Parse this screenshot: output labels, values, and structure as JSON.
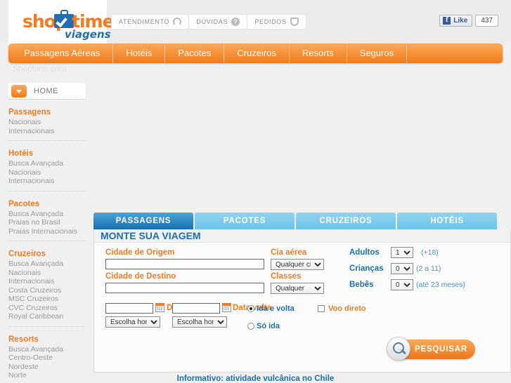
{
  "brand": {
    "logo_shop": "shop",
    "logo_time": "time",
    "logo_sub": "viagens",
    "site_label": "Shoptime.com"
  },
  "topbar": {
    "links": [
      {
        "label": "ATENDIMENTO",
        "icon": "headset-icon"
      },
      {
        "label": "DÚVIDAS",
        "icon": "question-circle-icon"
      },
      {
        "label": "PEDIDOS",
        "icon": "package-box-icon"
      }
    ],
    "facebook": {
      "like_label": "Like",
      "f_glyph": "f",
      "count": "437"
    }
  },
  "mainnav": {
    "items": [
      "Passagens Aéreas",
      "Hotéis",
      "Pacotes",
      "Cruzeiros",
      "Resorts",
      "Seguros"
    ]
  },
  "sidebar": {
    "home_label": "HOME",
    "groups": [
      {
        "title": "Passagens",
        "links": [
          "Nacionais",
          "Internacionais"
        ]
      },
      {
        "title": "Hotéis",
        "links": [
          "Busca Avançada",
          "Nacionais",
          "Internacionais"
        ]
      },
      {
        "title": "Pacotes",
        "links": [
          "Busca Avançada",
          "Praias no Brasil",
          "Praias Internacionais"
        ]
      },
      {
        "title": "Cruzeiros",
        "links": [
          "Busca Avançada",
          "Nacionais",
          "Internacionais",
          "Costa Cruzeiros",
          "MSC Cruzeiros",
          "CVC Cruzeiros",
          "Royal Caribbean"
        ]
      },
      {
        "title": "Resorts",
        "links": [
          "Busca Avançada",
          "Centro-Oeste",
          "Nordeste",
          "Norte"
        ]
      }
    ]
  },
  "booking": {
    "tabs": [
      {
        "label": "PASSAGENS",
        "active": true
      },
      {
        "label": "PACOTES",
        "active": false
      },
      {
        "label": "CRUZEIROS",
        "active": false
      },
      {
        "label": "HOTÉIS",
        "active": false
      }
    ],
    "panel_title": "MONTE SUA VIAGEM",
    "origin_label": "Cidade de Origem",
    "origin_value": "",
    "destination_label": "Cidade de Destino",
    "destination_value": "",
    "date_go_label": "Data ida",
    "date_go_value": "",
    "date_back_label": "Data volta",
    "date_back_value": "",
    "hour_go_value": "Escolha hora",
    "hour_back_value": "Escolha hora",
    "airline_label": "Cia aérea",
    "airline_value": "Qualquer cia",
    "class_label": "Classes",
    "class_value": "Qualquer",
    "adults_label": "Adultos",
    "adults_value": "1",
    "adults_hint": "(+18)",
    "children_label": "Crianças",
    "children_value": "0",
    "children_hint": "(2 a 11)",
    "babies_label": "Bebês",
    "babies_value": "0",
    "babies_hint": "(até 23 meses)",
    "trip_roundtrip": "Ida e volta",
    "trip_oneway": "Só ida",
    "trip_selected": "roundtrip",
    "direct_flight_label": "Voo direto",
    "direct_flight_checked": false,
    "search_label": "PESQUISAR"
  },
  "footer": {
    "informativo": "Informativo: atividade vulcânica no Chile"
  },
  "colors": {
    "orange": "#f47b20",
    "blue": "#1a6fae",
    "light_blue": "#6ec3e8",
    "grey_text": "#9a9a9a"
  }
}
